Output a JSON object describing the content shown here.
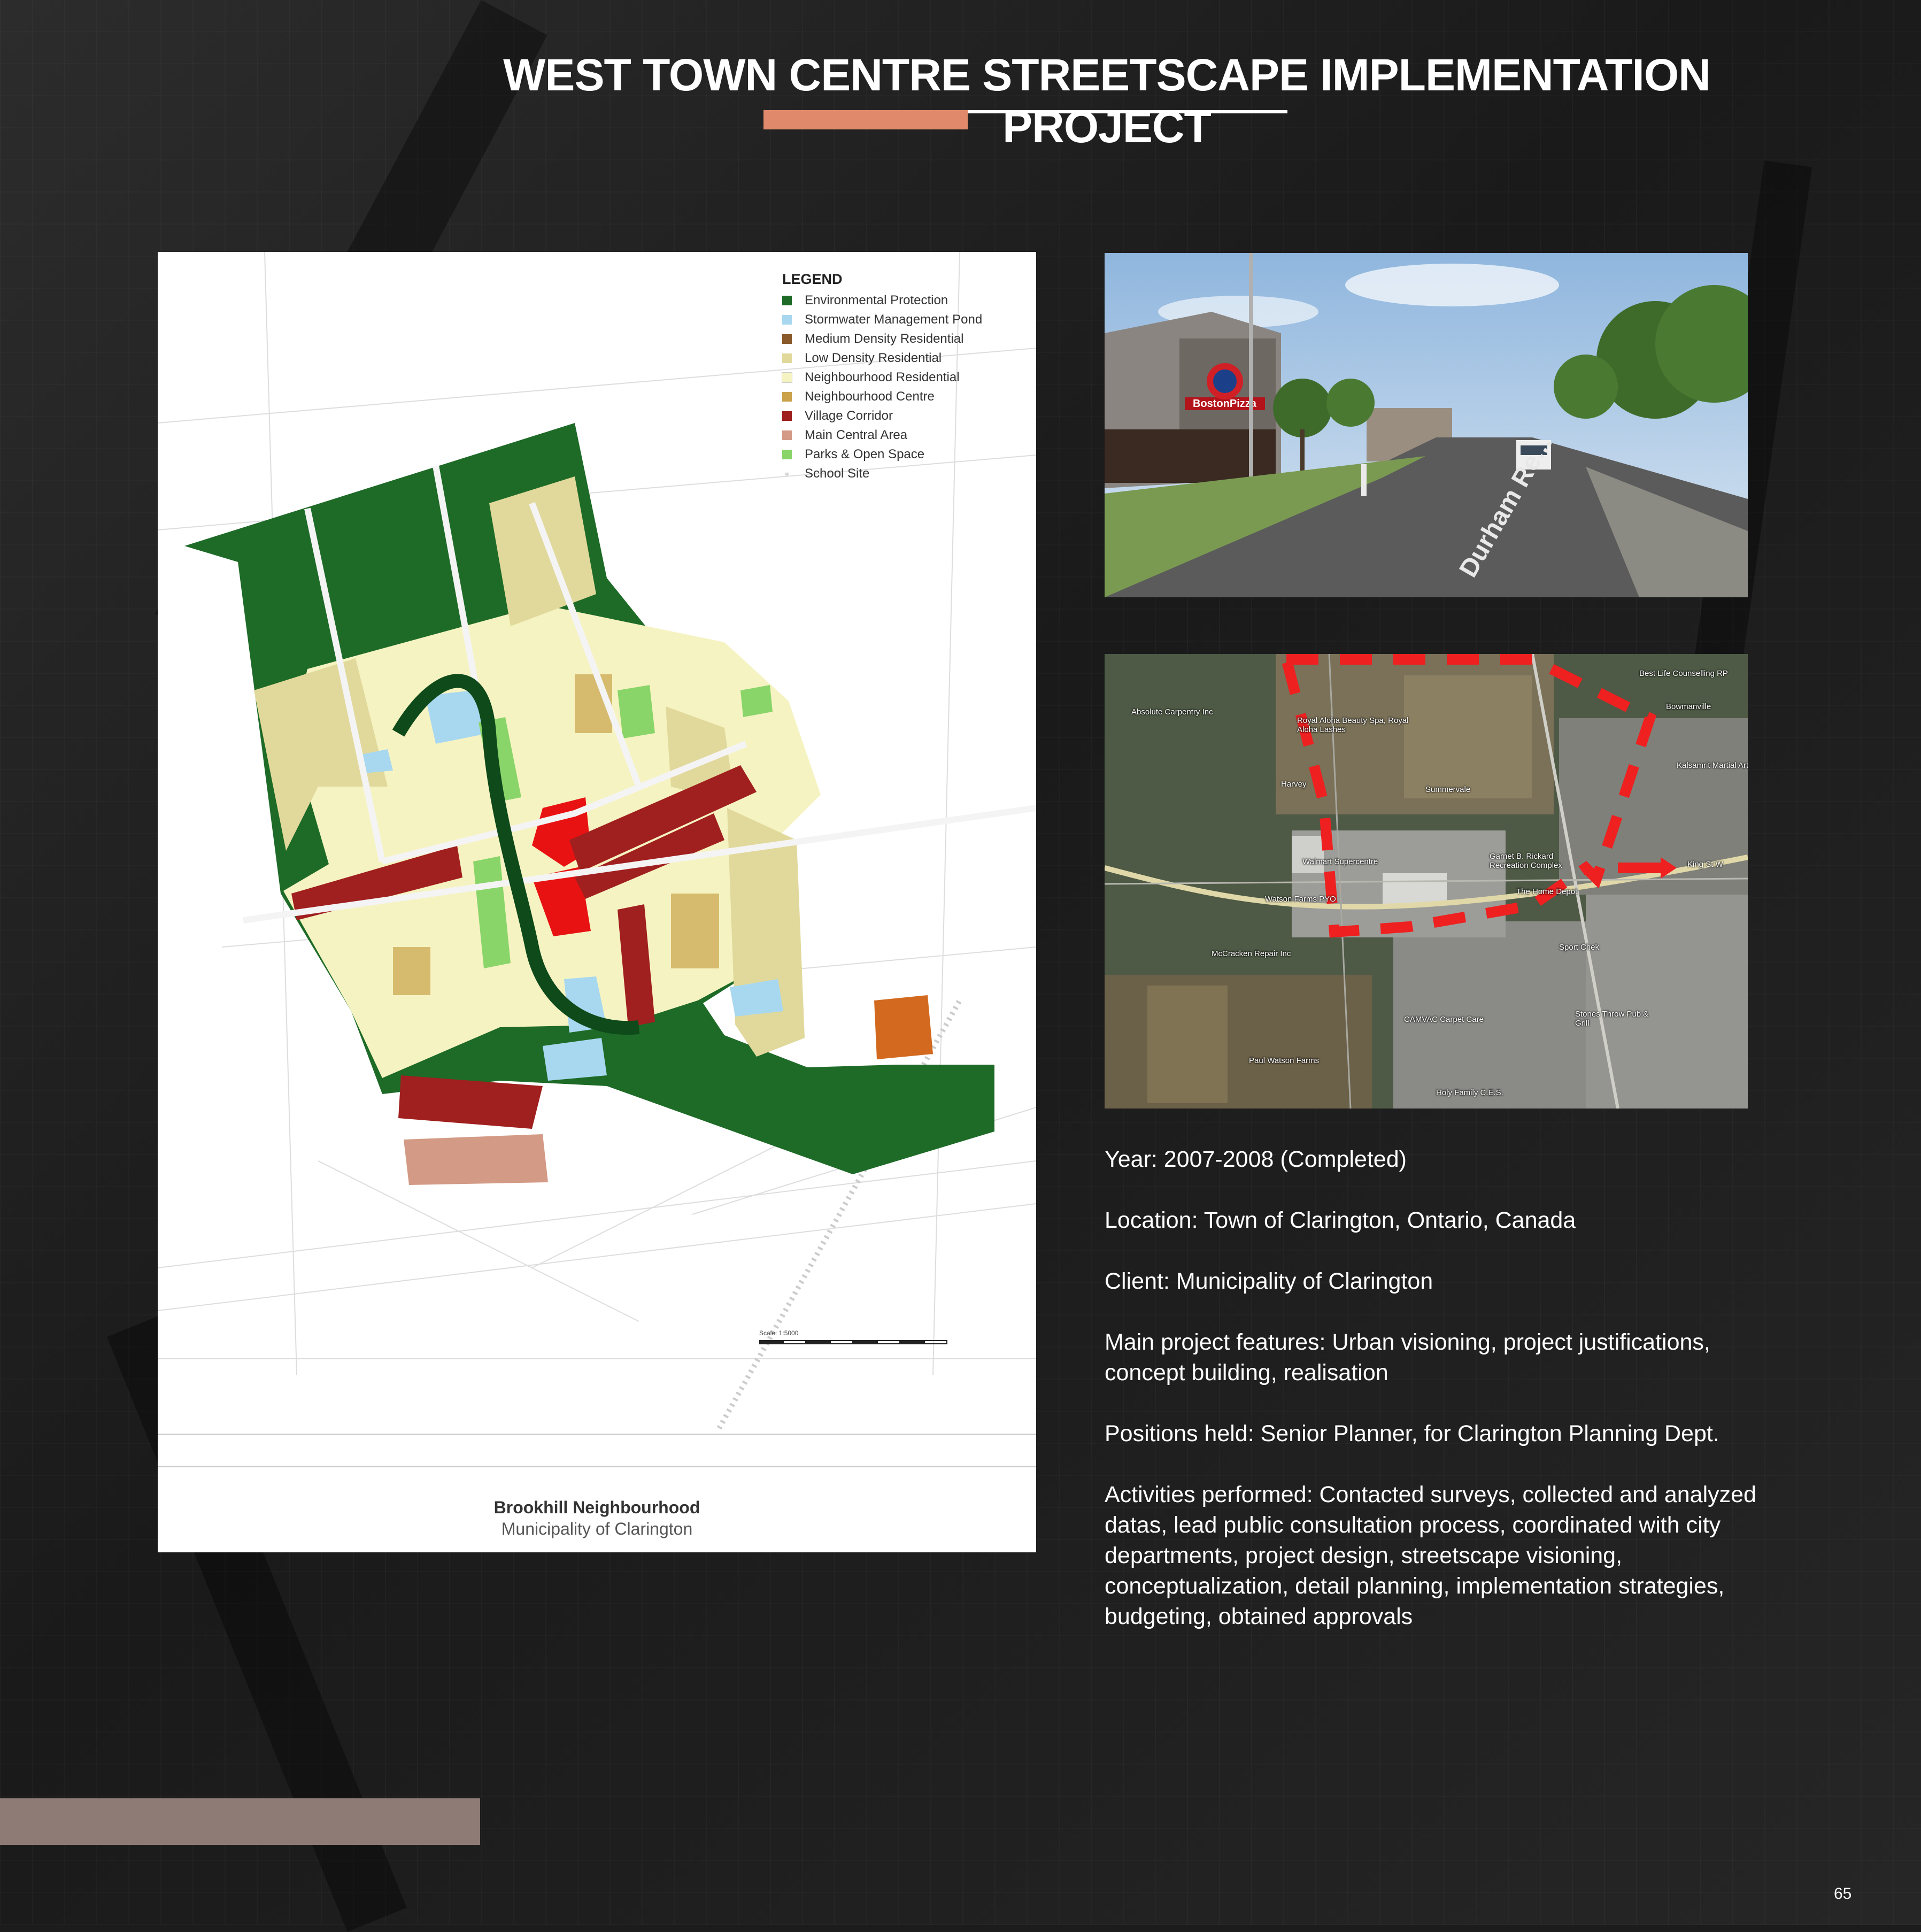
{
  "page": {
    "title": "WEST TOWN CENTRE STREETSCAPE IMPLEMENTATION PROJECT",
    "page_number": "65",
    "accent_color": "#e08a6b"
  },
  "map": {
    "legend_title": "LEGEND",
    "legend": [
      {
        "label": "Environmental Protection",
        "color": "#1e6b28"
      },
      {
        "label": "Stormwater Management Pond",
        "color": "#a8d8ef"
      },
      {
        "label": "Medium Density Residential",
        "color": "#8a5a2b"
      },
      {
        "label": "Low Density Residential",
        "color": "#e1d99b"
      },
      {
        "label": "Neighbourhood Residential",
        "color": "#f6f3c2"
      },
      {
        "label": "Neighbourhood Centre",
        "color": "#c9a24a"
      },
      {
        "label": "Village Corridor",
        "color": "#a01f1f"
      },
      {
        "label": "Main Central Area",
        "color": "#d39a85"
      },
      {
        "label": "Parks & Open Space",
        "color": "#8ad56a"
      },
      {
        "label": "School Site",
        "color": "#333333"
      }
    ],
    "scale_label": "Scale: 1:5000",
    "name": "Brookhill Neighbourhood",
    "subtitle": "Municipality of Clarington"
  },
  "street_photo": {
    "store_sign": "BostonPizza",
    "road_label": "Durham Re..."
  },
  "aerial": {
    "places": [
      "Best Life Counselling RP",
      "Absolute Carpentry Inc",
      "Royal Aloha Beauty Spa, Royal Aloha Lashes",
      "Bowmanville",
      "Summervale",
      "Kalsamrit Martial Arts",
      "Harvey",
      "Walmart Supercentre",
      "Garnet B. Rickard Recreation Complex",
      "King St W",
      "Watson Farms PYO",
      "The Home Depot",
      "McCracken Repair Inc",
      "Sport Chek",
      "CAMVAC Carpet Care",
      "Stones Throw Pub & Grill",
      "Paul Watson Farms",
      "Holy Family C.E.S."
    ]
  },
  "info": [
    "Year: 2007-2008 (Completed)",
    "Location: Town of Clarington, Ontario, Canada",
    "Client: Municipality of Clarington",
    "Main project features: Urban visioning, project justifications, concept building, realisation",
    "Positions held: Senior Planner, for Clarington Planning Dept.",
    "Activities performed: Contacted surveys, collected and analyzed datas, lead public consultation process, coordinated with city departments, project design, streetscape visioning, conceptualization, detail planning, implementation strategies, budgeting, obtained approvals"
  ]
}
